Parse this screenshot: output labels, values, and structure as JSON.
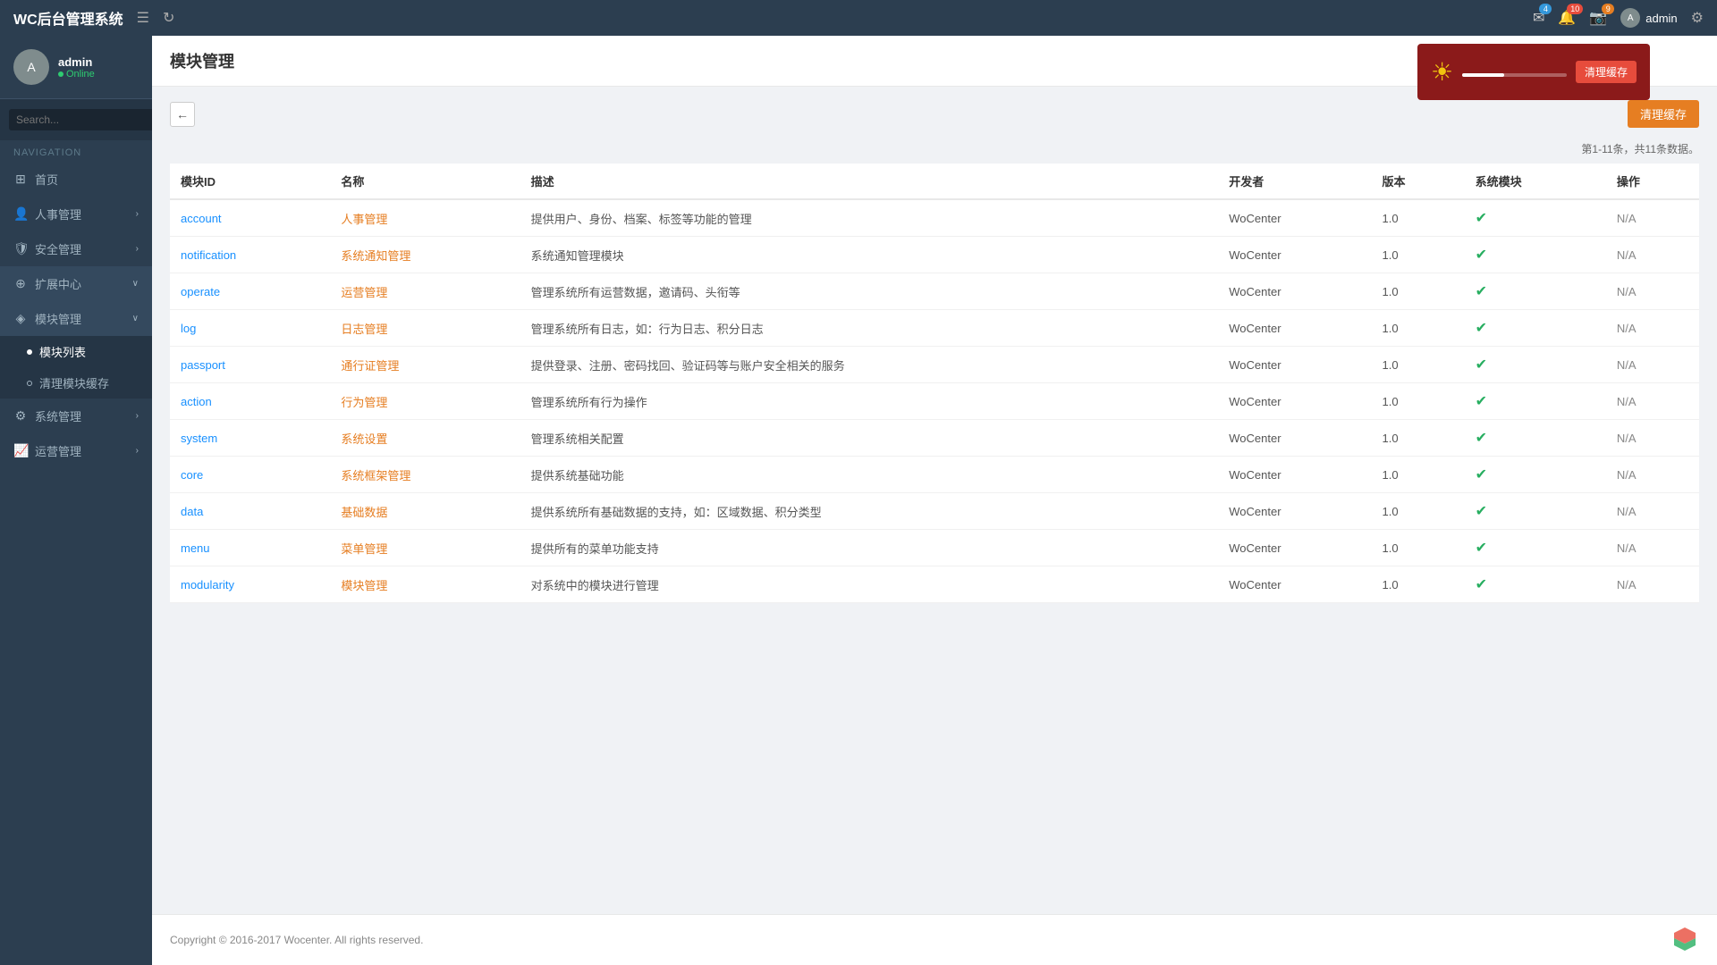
{
  "app": {
    "title": "WC后台管理系统"
  },
  "header": {
    "badges": {
      "mail": "4",
      "bell": "10",
      "camera": "9"
    },
    "admin_label": "admin"
  },
  "notification": {
    "text": "清理缓存",
    "button_label": "清理缓存"
  },
  "user": {
    "username": "admin",
    "status": "Online"
  },
  "search": {
    "placeholder": "Search..."
  },
  "nav": {
    "section_label": "NAVIGATION",
    "items": [
      {
        "id": "home",
        "label": "首页",
        "icon": "⊞"
      },
      {
        "id": "hr",
        "label": "人事管理",
        "icon": "👤",
        "has_arrow": true
      },
      {
        "id": "security",
        "label": "安全管理",
        "icon": "🛡",
        "has_arrow": true
      },
      {
        "id": "expand",
        "label": "扩展中心",
        "icon": "⊕",
        "has_arrow": true,
        "active": true
      },
      {
        "id": "module",
        "label": "模块管理",
        "icon": "◈",
        "has_arrow": true,
        "active": true
      },
      {
        "id": "sysadmin",
        "label": "系统管理",
        "icon": "⚙",
        "has_arrow": true
      },
      {
        "id": "ops",
        "label": "运营管理",
        "icon": "📈",
        "has_arrow": true
      }
    ],
    "sub_items": [
      {
        "id": "module-list",
        "label": "模块列表",
        "active": true
      },
      {
        "id": "clear-cache",
        "label": "清理模块缓存"
      }
    ]
  },
  "page": {
    "title": "模块管理",
    "pagination": "第1-11条，共11条数据。",
    "clear_cache_btn": "清理缓存"
  },
  "table": {
    "columns": [
      "模块ID",
      "名称",
      "描述",
      "开发者",
      "版本",
      "系统模块",
      "操作"
    ],
    "rows": [
      {
        "id": "account",
        "name": "人事管理",
        "desc": "提供用户、身份、档案、标签等功能的管理",
        "developer": "WoCenter",
        "version": "1.0",
        "is_system": true,
        "action": "N/A"
      },
      {
        "id": "notification",
        "name": "系统通知管理",
        "desc": "系统通知管理模块",
        "developer": "WoCenter",
        "version": "1.0",
        "is_system": true,
        "action": "N/A"
      },
      {
        "id": "operate",
        "name": "运营管理",
        "desc": "管理系统所有运营数据，邀请码、头衔等",
        "developer": "WoCenter",
        "version": "1.0",
        "is_system": true,
        "action": "N/A"
      },
      {
        "id": "log",
        "name": "日志管理",
        "desc": "管理系统所有日志，如：行为日志、积分日志",
        "developer": "WoCenter",
        "version": "1.0",
        "is_system": true,
        "action": "N/A"
      },
      {
        "id": "passport",
        "name": "通行证管理",
        "desc": "提供登录、注册、密码找回、验证码等与账户安全相关的服务",
        "developer": "WoCenter",
        "version": "1.0",
        "is_system": true,
        "action": "N/A"
      },
      {
        "id": "action",
        "name": "行为管理",
        "desc": "管理系统所有行为操作",
        "developer": "WoCenter",
        "version": "1.0",
        "is_system": true,
        "action": "N/A"
      },
      {
        "id": "system",
        "name": "系统设置",
        "desc": "管理系统相关配置",
        "developer": "WoCenter",
        "version": "1.0",
        "is_system": true,
        "action": "N/A"
      },
      {
        "id": "core",
        "name": "系统框架管理",
        "desc": "提供系统基础功能",
        "developer": "WoCenter",
        "version": "1.0",
        "is_system": true,
        "action": "N/A"
      },
      {
        "id": "data",
        "name": "基础数据",
        "desc": "提供系统所有基础数据的支持，如：区域数据、积分类型",
        "developer": "WoCenter",
        "version": "1.0",
        "is_system": true,
        "action": "N/A"
      },
      {
        "id": "menu",
        "name": "菜单管理",
        "desc": "提供所有的菜单功能支持",
        "developer": "WoCenter",
        "version": "1.0",
        "is_system": true,
        "action": "N/A"
      },
      {
        "id": "modularity",
        "name": "模块管理",
        "desc": "对系统中的模块进行管理",
        "developer": "WoCenter",
        "version": "1.0",
        "is_system": true,
        "action": "N/A"
      }
    ]
  },
  "footer": {
    "copyright": "Copyright © 2016-2017 Wocenter. All rights reserved."
  }
}
